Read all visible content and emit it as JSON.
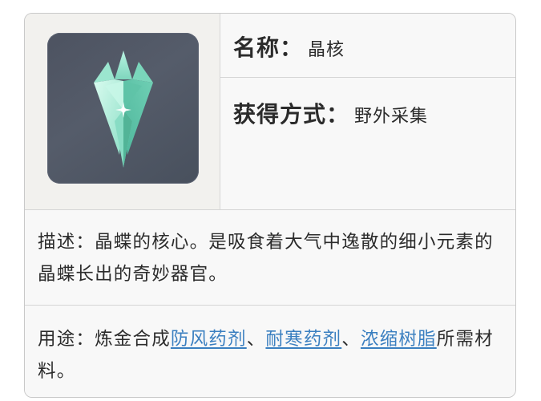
{
  "item": {
    "icon": "crystal-core-icon",
    "name_label": "名称：",
    "name_value": "晶核",
    "source_label": "获得方式：",
    "source_value": "野外采集"
  },
  "description": {
    "text": "描述：晶蝶的核心。是吸食着大气中逸散的细小元素的晶蝶长出的奇妙器官。"
  },
  "usage": {
    "prefix": "用途：炼金合成",
    "links": [
      "防风药剂",
      "耐寒药剂",
      "浓缩树脂"
    ],
    "separator": "、",
    "suffix": "所需材料。",
    "link_color": "#3a7fc0"
  }
}
